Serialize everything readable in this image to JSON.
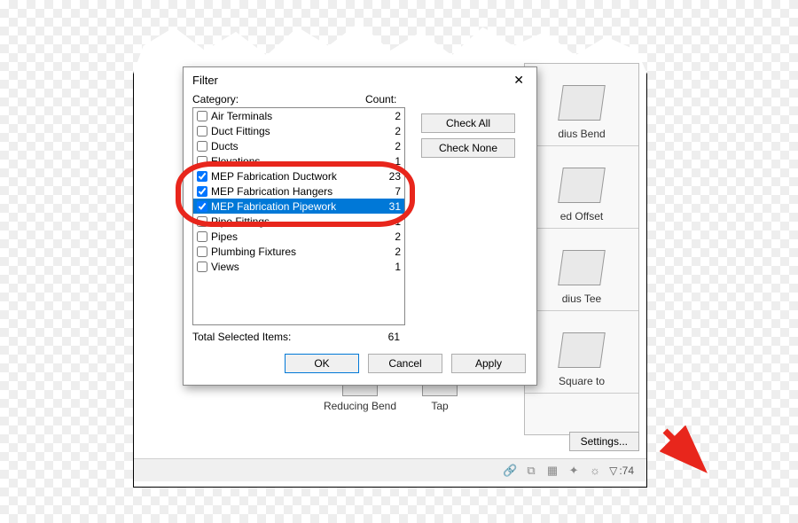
{
  "dialog": {
    "title": "Filter",
    "category_header": "Category:",
    "count_header": "Count:",
    "check_all": "Check All",
    "check_none": "Check None",
    "total_label": "Total Selected Items:",
    "total_value": "61",
    "ok": "OK",
    "cancel": "Cancel",
    "apply": "Apply",
    "rows": [
      {
        "label": "Air Terminals",
        "count": "2",
        "checked": false,
        "selected": false
      },
      {
        "label": "Duct Fittings",
        "count": "2",
        "checked": false,
        "selected": false
      },
      {
        "label": "Ducts",
        "count": "2",
        "checked": false,
        "selected": false
      },
      {
        "label": "Elevations",
        "count": "1",
        "checked": false,
        "selected": false
      },
      {
        "label": "MEP Fabrication Ductwork",
        "count": "23",
        "checked": true,
        "selected": false
      },
      {
        "label": "MEP Fabrication Hangers",
        "count": "7",
        "checked": true,
        "selected": false
      },
      {
        "label": "MEP Fabrication Pipework",
        "count": "31",
        "checked": true,
        "selected": true
      },
      {
        "label": "Pipe Fittings",
        "count": "1",
        "checked": false,
        "selected": false
      },
      {
        "label": "Pipes",
        "count": "2",
        "checked": false,
        "selected": false
      },
      {
        "label": "Plumbing Fixtures",
        "count": "2",
        "checked": false,
        "selected": false
      },
      {
        "label": "Views",
        "count": "1",
        "checked": false,
        "selected": false
      }
    ]
  },
  "library": {
    "i0": "dius Bend",
    "i1": "ed Offset",
    "i2": "dius Tee",
    "i3": "Square to"
  },
  "bottom": {
    "c0": "Reducing Bend",
    "c1": "Tap"
  },
  "settings_btn": "Settings...",
  "status": {
    "filter_count": ":74"
  }
}
